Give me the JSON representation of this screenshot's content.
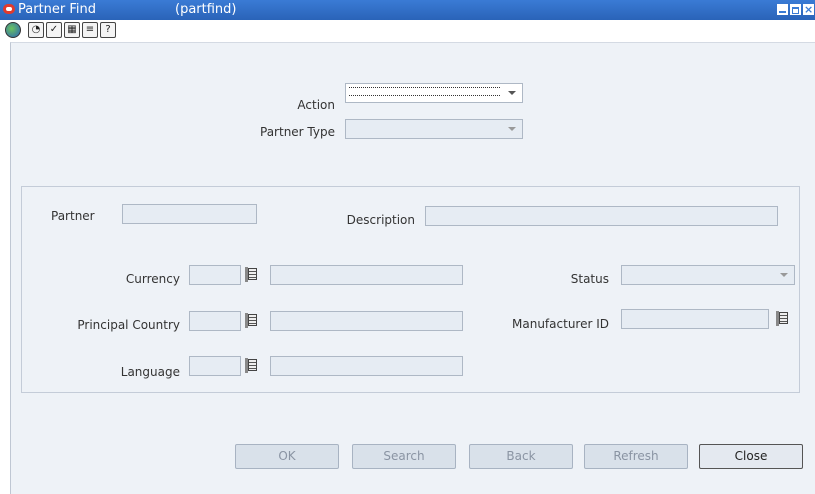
{
  "window": {
    "title": "Partner Find",
    "subtitle": "(partfind)"
  },
  "toolbar": {
    "icons": [
      "globe-icon",
      "help-circle-icon",
      "spellcheck-icon",
      "calendar-icon",
      "notes-icon",
      "help-icon"
    ]
  },
  "header": {
    "action_label": "Action",
    "action_value": "",
    "partner_type_label": "Partner Type",
    "partner_type_value": ""
  },
  "form": {
    "partner_label": "Partner",
    "partner_value": "",
    "description_label": "Description",
    "description_value": "",
    "currency_label": "Currency",
    "currency_code": "",
    "currency_desc": "",
    "status_label": "Status",
    "status_value": "",
    "principal_country_label": "Principal Country",
    "country_code": "",
    "country_desc": "",
    "manufacturer_id_label": "Manufacturer ID",
    "manufacturer_id_value": "",
    "language_label": "Language",
    "language_code": "",
    "language_desc": ""
  },
  "buttons": {
    "ok": "OK",
    "search": "Search",
    "back": "Back",
    "refresh": "Refresh",
    "close": "Close"
  }
}
